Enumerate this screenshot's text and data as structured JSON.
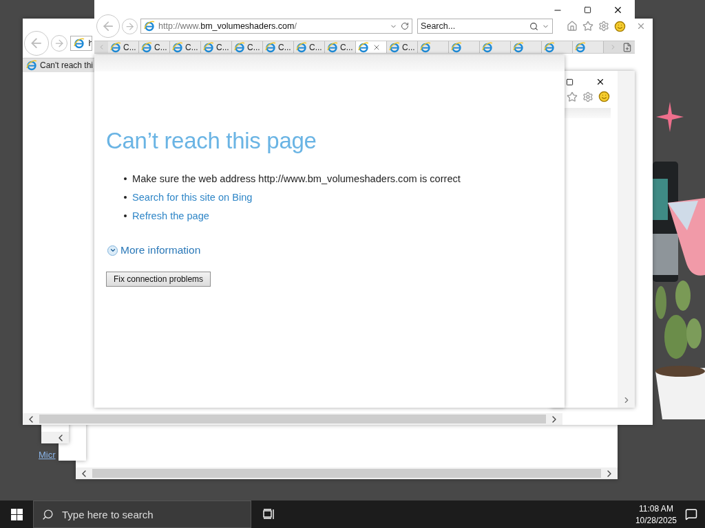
{
  "back_window": {
    "address": "h",
    "tab_title": "Can't reach thi"
  },
  "desktop_link": "Micr",
  "browser": {
    "address": {
      "prefix": "http://www.",
      "domain": "bm_volumeshaders.com",
      "suffix": "/"
    },
    "search_placeholder": "Search...",
    "tabs": [
      {
        "label": "C...",
        "selected": false
      },
      {
        "label": "C...",
        "selected": false
      },
      {
        "label": "C...",
        "selected": false
      },
      {
        "label": "C...",
        "selected": false
      },
      {
        "label": "C...",
        "selected": false
      },
      {
        "label": "C...",
        "selected": false
      },
      {
        "label": "C...",
        "selected": false
      },
      {
        "label": "C...",
        "selected": false
      },
      {
        "selected": true
      },
      {
        "label": "C...",
        "selected": false
      },
      {
        "selected": false
      },
      {
        "selected": false
      },
      {
        "selected": false
      },
      {
        "selected": false
      },
      {
        "selected": false
      },
      {
        "selected": false
      }
    ]
  },
  "error_page": {
    "heading": "Can’t reach this page",
    "items": [
      {
        "kind": "text",
        "text": "Make sure the web address http://www.bm_volumeshaders.com is correct"
      },
      {
        "kind": "link",
        "text": "Search for this site on Bing"
      },
      {
        "kind": "link",
        "text": "Refresh the page"
      }
    ],
    "more_info": {
      "label": "More information",
      "expanded": false
    },
    "button": "Fix connection problems"
  },
  "taskbar": {
    "search_placeholder": "Type here to search",
    "time": "11:08 AM",
    "date": "10/28/2025"
  }
}
